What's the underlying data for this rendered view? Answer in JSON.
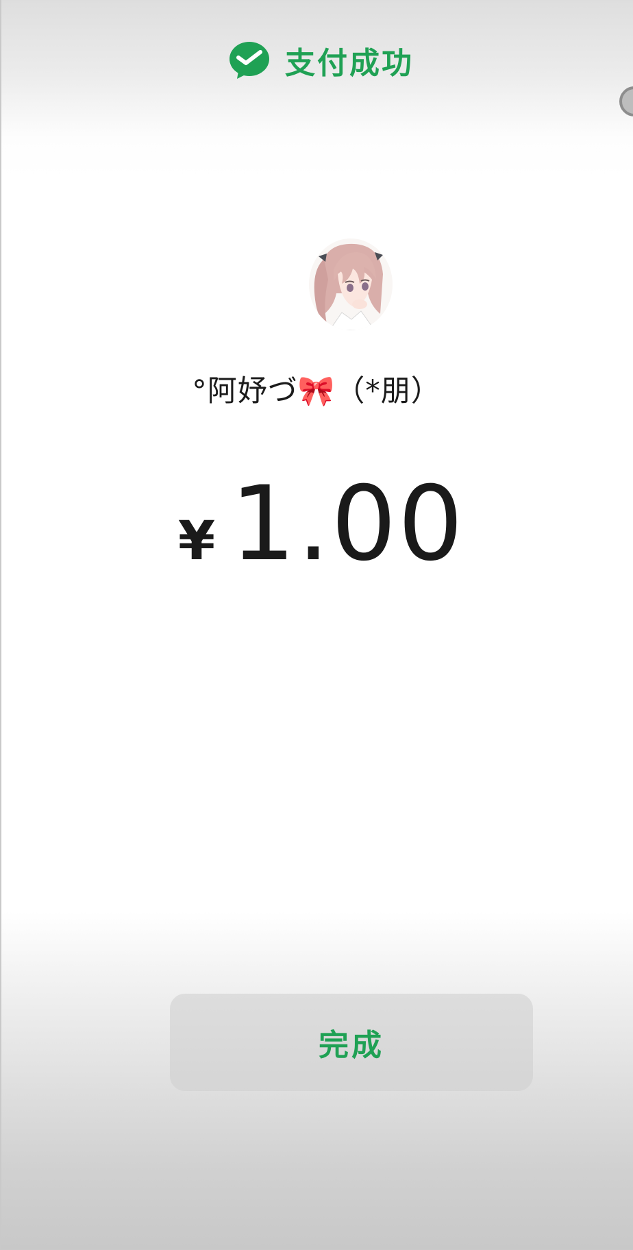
{
  "header": {
    "icon": "wechat-pay-icon",
    "title": "支付成功"
  },
  "payee": {
    "avatar_icon": "anime-girl-avatar",
    "name": "°阿妤づ🎀（*朋）"
  },
  "amount": {
    "currency": "¥",
    "value": "1.00"
  },
  "actions": {
    "done_label": "完成"
  },
  "colors": {
    "accent": "#1fa154",
    "text": "#1a1a1a"
  }
}
